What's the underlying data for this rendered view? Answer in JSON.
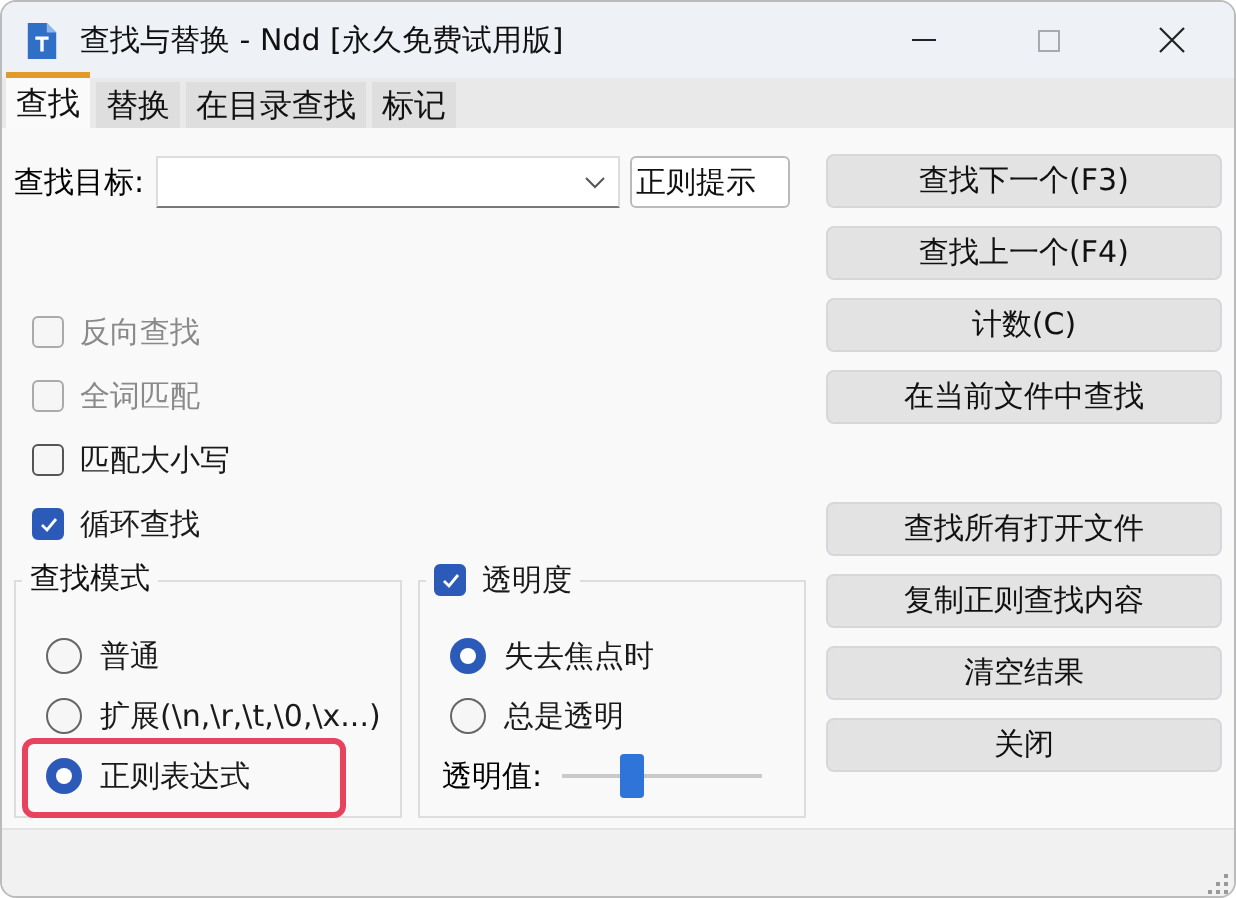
{
  "window": {
    "title": "查找与替换 - Ndd [永久免费试用版]"
  },
  "tabs": [
    {
      "label": "查找",
      "selected": true
    },
    {
      "label": "替换",
      "selected": false
    },
    {
      "label": "在目录查找",
      "selected": false
    },
    {
      "label": "标记",
      "selected": false
    }
  ],
  "search": {
    "label": "查找目标:",
    "hint_button": "正则提示"
  },
  "options": [
    {
      "label": "反向查找",
      "checked": false,
      "disabled": true
    },
    {
      "label": "全词匹配",
      "checked": false,
      "disabled": true
    },
    {
      "label": "匹配大小写",
      "checked": false,
      "disabled": false
    },
    {
      "label": "循环查找",
      "checked": true,
      "disabled": false
    }
  ],
  "search_mode": {
    "title": "查找模式",
    "options": [
      {
        "label": "普通",
        "selected": false,
        "highlighted": false
      },
      {
        "label": "扩展(\\n,\\r,\\t,\\0,\\x...)",
        "selected": false,
        "highlighted": false
      },
      {
        "label": "正则表达式",
        "selected": true,
        "highlighted": true
      }
    ]
  },
  "transparency": {
    "label": "透明度",
    "checked": true,
    "options": [
      {
        "label": "失去焦点时",
        "selected": true
      },
      {
        "label": "总是透明",
        "selected": false
      }
    ],
    "slider": {
      "label": "透明值:",
      "level": 0.35
    }
  },
  "button_groups": [
    [
      "查找下一个(F3)",
      "查找上一个(F4)",
      "计数(C)",
      "在当前文件中查找"
    ],
    [
      "查找所有打开文件",
      "复制正则查找内容",
      "清空结果",
      "关闭"
    ]
  ]
}
